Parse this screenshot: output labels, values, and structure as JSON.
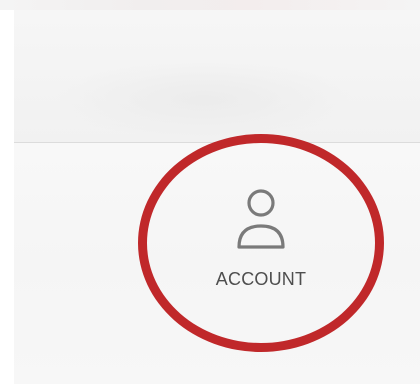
{
  "account_tab": {
    "label": "ACCOUNT",
    "icon": "user-icon"
  },
  "colors": {
    "highlight_ring": "#c0282a",
    "icon_stroke": "#7a7a7a",
    "label_text": "#4e4e4e",
    "panel_bg": "#f5f5f5"
  }
}
